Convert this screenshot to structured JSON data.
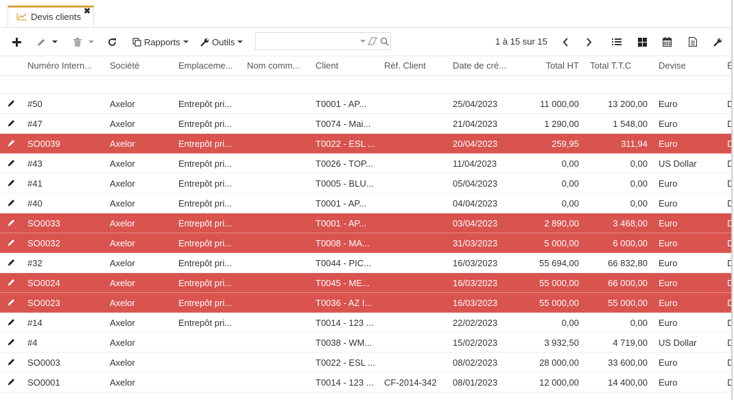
{
  "tab": {
    "title": "Devis clients",
    "close": "✖"
  },
  "toolbar": {
    "reports_label": "Rapports",
    "tools_label": "Outils",
    "search_placeholder": ""
  },
  "pager": {
    "text": "1 à 15 sur 15"
  },
  "columns": [
    "Numéro Intern...",
    "Société",
    "Emplaceme...",
    "Nom comm...",
    "Client",
    "Réf. Client",
    "Date de cré...",
    "Total HT",
    "Total T.T.C",
    "Devise",
    "É"
  ],
  "colors": {
    "highlight": "#d9534f",
    "tab_accent": "#d9a441"
  },
  "rows": [
    {
      "num": "#50",
      "company": "Axelor",
      "location": "Entrepôt pri...",
      "name": "",
      "client": "T0001 - AP...",
      "ref": "",
      "date": "25/04/2023",
      "ht": "11 000,00",
      "ttc": "13 200,00",
      "currency": "Euro",
      "status": "D",
      "hl": false
    },
    {
      "num": "#47",
      "company": "Axelor",
      "location": "Entrepôt pri...",
      "name": "",
      "client": "T0074 - Mai...",
      "ref": "",
      "date": "21/04/2023",
      "ht": "1 290,00",
      "ttc": "1 548,00",
      "currency": "Euro",
      "status": "D",
      "hl": false
    },
    {
      "num": "SO0039",
      "company": "Axelor",
      "location": "Entrepôt pri...",
      "name": "",
      "client": "T0022 - ESL ...",
      "ref": "",
      "date": "20/04/2023",
      "ht": "259,95",
      "ttc": "311,94",
      "currency": "Euro",
      "status": "D",
      "hl": true
    },
    {
      "num": "#43",
      "company": "Axelor",
      "location": "Entrepôt pri...",
      "name": "",
      "client": "T0026 - TOP...",
      "ref": "",
      "date": "11/04/2023",
      "ht": "0,00",
      "ttc": "0,00",
      "currency": "US Dollar",
      "status": "D",
      "hl": false
    },
    {
      "num": "#41",
      "company": "Axelor",
      "location": "Entrepôt pri...",
      "name": "",
      "client": "T0005 - BLU...",
      "ref": "",
      "date": "05/04/2023",
      "ht": "0,00",
      "ttc": "0,00",
      "currency": "Euro",
      "status": "D",
      "hl": false
    },
    {
      "num": "#40",
      "company": "Axelor",
      "location": "Entrepôt pri...",
      "name": "",
      "client": "T0001 - AP...",
      "ref": "",
      "date": "04/04/2023",
      "ht": "0,00",
      "ttc": "0,00",
      "currency": "Euro",
      "status": "D",
      "hl": false
    },
    {
      "num": "SO0033",
      "company": "Axelor",
      "location": "Entrepôt pri...",
      "name": "",
      "client": "T0001 - AP...",
      "ref": "",
      "date": "03/04/2023",
      "ht": "2 890,00",
      "ttc": "3 468,00",
      "currency": "Euro",
      "status": "D",
      "hl": true
    },
    {
      "num": "SO0032",
      "company": "Axelor",
      "location": "Entrepôt pri...",
      "name": "",
      "client": "T0008 - MA...",
      "ref": "",
      "date": "31/03/2023",
      "ht": "5 000,00",
      "ttc": "6 000,00",
      "currency": "Euro",
      "status": "D",
      "hl": true
    },
    {
      "num": "#32",
      "company": "Axelor",
      "location": "Entrepôt pri...",
      "name": "",
      "client": "T0044 - PIC...",
      "ref": "",
      "date": "16/03/2023",
      "ht": "55 694,00",
      "ttc": "66 832,80",
      "currency": "Euro",
      "status": "D",
      "hl": false
    },
    {
      "num": "SO0024",
      "company": "Axelor",
      "location": "Entrepôt pri...",
      "name": "",
      "client": "T0045 - ME...",
      "ref": "",
      "date": "16/03/2023",
      "ht": "55 000,00",
      "ttc": "66 000,00",
      "currency": "Euro",
      "status": "D",
      "hl": true
    },
    {
      "num": "SO0023",
      "company": "Axelor",
      "location": "Entrepôt pri...",
      "name": "",
      "client": "T0036 - AZ I...",
      "ref": "",
      "date": "16/03/2023",
      "ht": "55 000,00",
      "ttc": "55 000,00",
      "currency": "Euro",
      "status": "D",
      "hl": true
    },
    {
      "num": "#14",
      "company": "Axelor",
      "location": "Entrepôt pri...",
      "name": "",
      "client": "T0014 - 123 ...",
      "ref": "",
      "date": "22/02/2023",
      "ht": "0,00",
      "ttc": "0,00",
      "currency": "Euro",
      "status": "D",
      "hl": false
    },
    {
      "num": "#4",
      "company": "Axelor",
      "location": "",
      "name": "",
      "client": "T0038 - WM...",
      "ref": "",
      "date": "15/02/2023",
      "ht": "3 932,50",
      "ttc": "4 719,00",
      "currency": "US Dollar",
      "status": "D",
      "hl": false
    },
    {
      "num": "SO0003",
      "company": "Axelor",
      "location": "",
      "name": "",
      "client": "T0022 - ESL ...",
      "ref": "",
      "date": "08/02/2023",
      "ht": "28 000,00",
      "ttc": "33 600,00",
      "currency": "Euro",
      "status": "D",
      "hl": false
    },
    {
      "num": "SO0001",
      "company": "Axelor",
      "location": "",
      "name": "",
      "client": "T0014 - 123 ...",
      "ref": "CF-2014-342",
      "date": "08/01/2023",
      "ht": "12 000,00",
      "ttc": "14 400,00",
      "currency": "Euro",
      "status": "D",
      "hl": false
    }
  ]
}
